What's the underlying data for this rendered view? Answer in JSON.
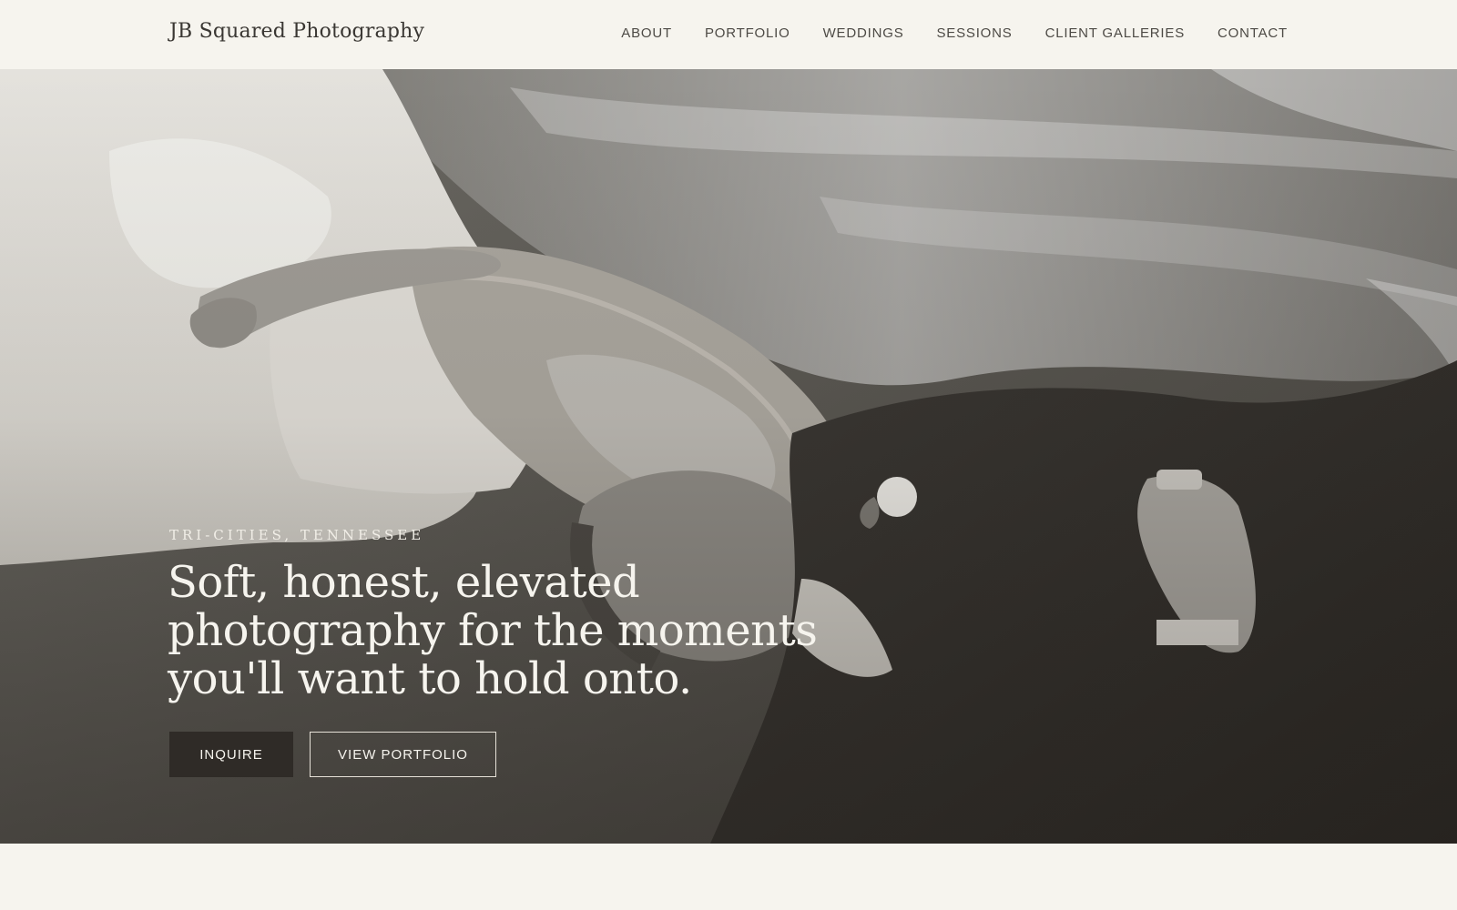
{
  "header": {
    "brand": "JB Squared Photography",
    "nav": [
      "ABOUT",
      "PORTFOLIO",
      "WEDDINGS",
      "SESSIONS",
      "CLIENT GALLERIES",
      "CONTACT"
    ]
  },
  "hero": {
    "image_icon": "wedding-couple-photo",
    "eyebrow": "TRI-CITIES, TENNESSEE",
    "headline": "Soft, honest, elevated photography for the moments you'll want to hold onto.",
    "buttons": {
      "inquire": "INQUIRE",
      "portfolio": "VIEW PORTFOLIO"
    }
  },
  "colors": {
    "background": "#f6f4ee",
    "text_dark": "#3a3733",
    "button_dark": "#2f2b27",
    "hero_text": "#f6f4ee"
  }
}
